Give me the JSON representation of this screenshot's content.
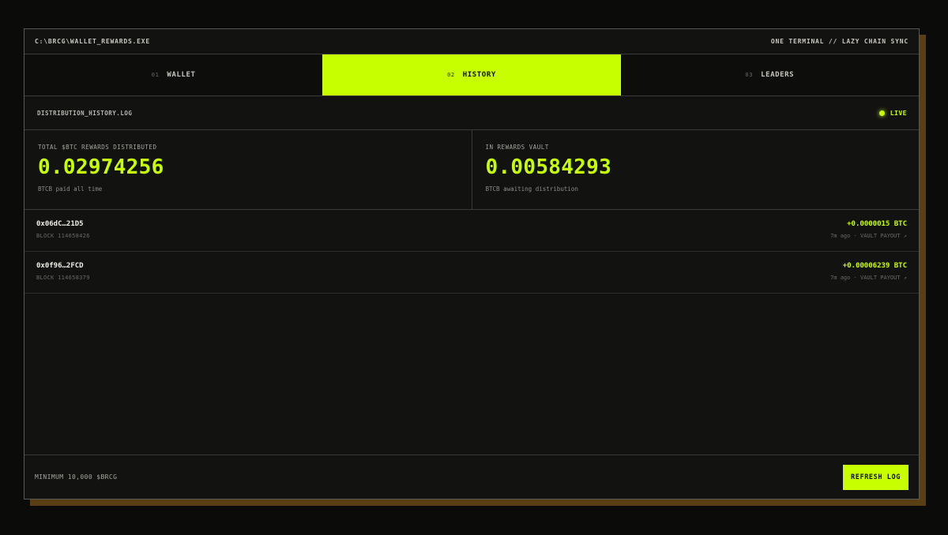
{
  "window": {
    "title": "C:\\BRCG\\WALLET_REWARDS.EXE",
    "subtitle": "ONE TERMINAL // LAZY CHAIN SYNC"
  },
  "tabs": [
    {
      "num": "01",
      "label": "WALLET",
      "active": false
    },
    {
      "num": "02",
      "label": "HISTORY",
      "active": true
    },
    {
      "num": "03",
      "label": "LEADERS",
      "active": false
    }
  ],
  "log": {
    "name": "DISTRIBUTION_HISTORY.LOG",
    "status": "LIVE"
  },
  "stats": {
    "distributed": {
      "label": "TOTAL $BTC REWARDS DISTRIBUTED",
      "value": "0.02974256",
      "sub": "BTCB paid all time"
    },
    "vault": {
      "label": "IN REWARDS VAULT",
      "value": "0.00584293",
      "sub": "BTCB awaiting distribution"
    }
  },
  "history": [
    {
      "address": "0x06dC…21D5",
      "block": "BLOCK 114658426",
      "amount": "+0.0000015 BTC",
      "meta": "7m ago · VAULT PAYOUT ↗"
    },
    {
      "address": "0x0f96…2FCD",
      "block": "BLOCK 114658379",
      "amount": "+0.00006239 BTC",
      "meta": "7m ago · VAULT PAYOUT ↗"
    }
  ],
  "footer": {
    "minimum": "MINIMUM 10,000 $BRCG",
    "refresh_label": "REFRESH LOG"
  },
  "colors": {
    "accent": "#c8ff00",
    "background": "#0b0b0a",
    "panel": "#121211",
    "shadow": "#5a3e14"
  }
}
